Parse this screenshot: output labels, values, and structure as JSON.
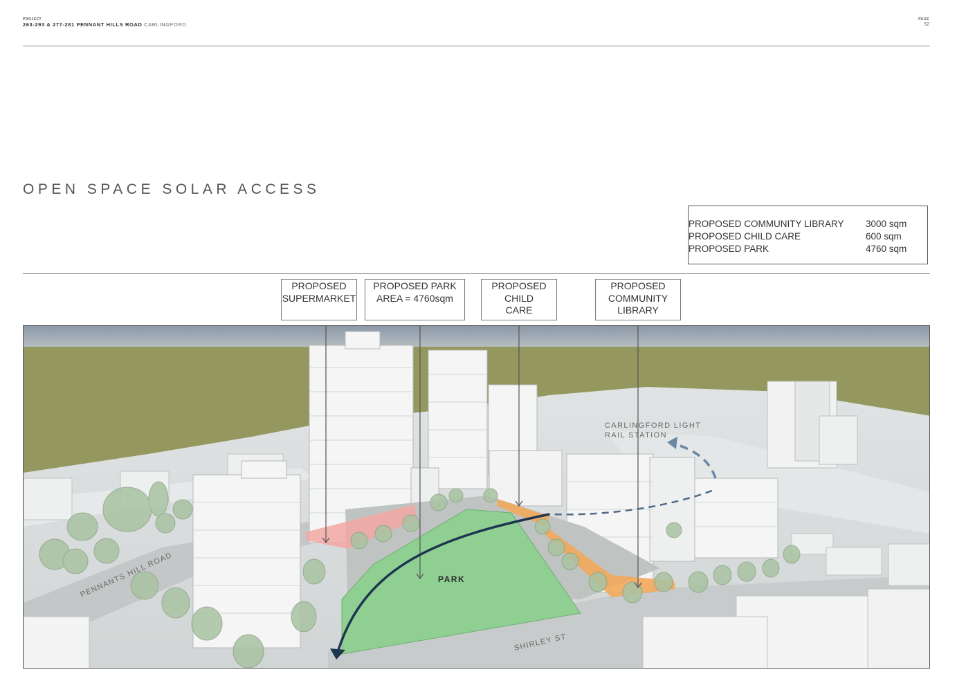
{
  "header": {
    "project_label": "PROJECT",
    "project_name": "263-293 & 277-281 PENNANT HILLS ROAD",
    "project_suburb": "CARLINGFORD",
    "page_label": "PAGE",
    "page_number": "52"
  },
  "title": "OPEN SPACE SOLAR ACCESS",
  "areas": [
    {
      "name": "PROPOSED COMMUNITY LIBRARY",
      "value": "3000 sqm"
    },
    {
      "name": "PROPOSED CHILD CARE",
      "value": "600 sqm"
    },
    {
      "name": "PROPOSED PARK",
      "value": "4760 sqm"
    }
  ],
  "callouts": {
    "supermarket": {
      "line1": "PROPOSED",
      "line2": "SUPERMARKET"
    },
    "park": {
      "line1": "PROPOSED PARK",
      "line2": "AREA = 4760sqm"
    },
    "childcare": {
      "line1": "PROPOSED",
      "line2": "CHILD",
      "line3": "CARE"
    },
    "library": {
      "line1": "PROPOSED",
      "line2": "COMMUNITY",
      "line3": "LIBRARY"
    }
  },
  "map_labels": {
    "park": "PARK",
    "rail_station_line1": "CARLINGFORD LIGHT",
    "rail_station_line2": "RAIL STATION",
    "pennants_hill_road": "PENNANTS HILL ROAD",
    "shirley_st": "SHIRLEY ST"
  },
  "colors": {
    "park_green": "#8fcf92",
    "supermarket_pink": "#f2a8a3",
    "library_orange": "#f2a95c",
    "sun_path_navy": "#1d3550",
    "grass": "#94975e"
  }
}
